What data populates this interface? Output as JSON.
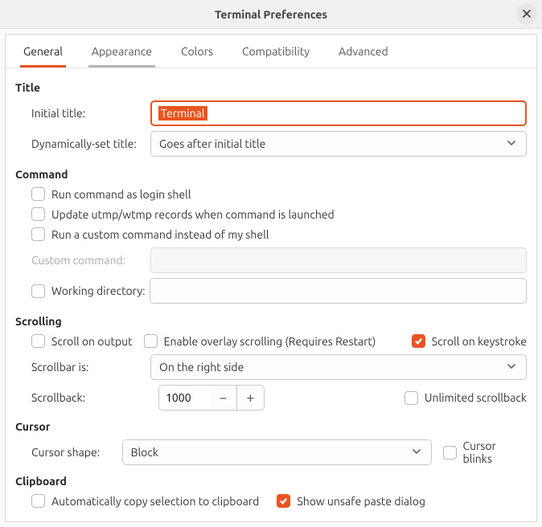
{
  "window": {
    "title": "Terminal Preferences"
  },
  "tabs": [
    "General",
    "Appearance",
    "Colors",
    "Compatibility",
    "Advanced"
  ],
  "title": {
    "heading": "Title",
    "initial_label": "Initial title:",
    "initial_value": "Terminal",
    "dyn_label": "Dynamically-set title:",
    "dyn_value": "Goes after initial title"
  },
  "command": {
    "heading": "Command",
    "login_shell": "Run command as login shell",
    "update_utmp": "Update utmp/wtmp records when command is launched",
    "custom_cmd_check": "Run a custom command instead of my shell",
    "custom_cmd_label": "Custom command:",
    "working_dir_label": "Working directory:"
  },
  "scrolling": {
    "heading": "Scrolling",
    "on_output": "Scroll on output",
    "overlay": "Enable overlay scrolling (Requires Restart)",
    "on_keystroke": "Scroll on keystroke",
    "scrollbar_label": "Scrollbar is:",
    "scrollbar_value": "On the right side",
    "scrollback_label": "Scrollback:",
    "scrollback_value": "1000",
    "unlimited": "Unlimited scrollback"
  },
  "cursor": {
    "heading": "Cursor",
    "shape_label": "Cursor shape:",
    "shape_value": "Block",
    "blinks": "Cursor blinks"
  },
  "clipboard": {
    "heading": "Clipboard",
    "auto_copy": "Automatically copy selection to clipboard",
    "unsafe_paste": "Show unsafe paste dialog"
  },
  "colors": {
    "accent": "#e95420"
  }
}
